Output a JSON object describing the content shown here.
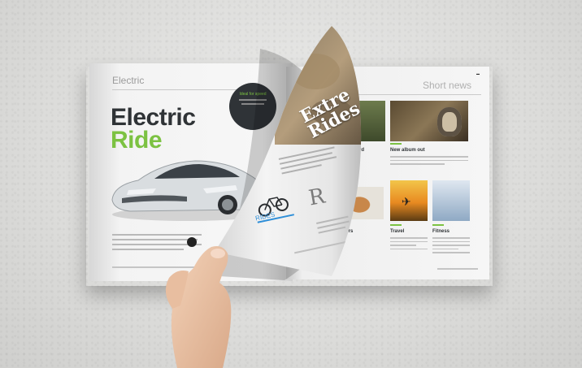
{
  "left_page": {
    "section": "Electric",
    "badge_text": "Ideal for speed",
    "title_line1": "Electric",
    "title_line2": "Ride"
  },
  "curl_page": {
    "headline": "Extre Rides",
    "drop_cap": "R",
    "caption": "RIDES"
  },
  "right_page": {
    "section": "Short news",
    "items": [
      {
        "heading": "ward"
      },
      {
        "heading": "New album out"
      },
      {
        "heading": "burgers"
      },
      {
        "heading": "Travel"
      },
      {
        "heading": "Fitness"
      }
    ]
  },
  "colors": {
    "accent_green": "#7cc242",
    "dark": "#2f3336",
    "blue_accent": "#2f8fd8"
  }
}
